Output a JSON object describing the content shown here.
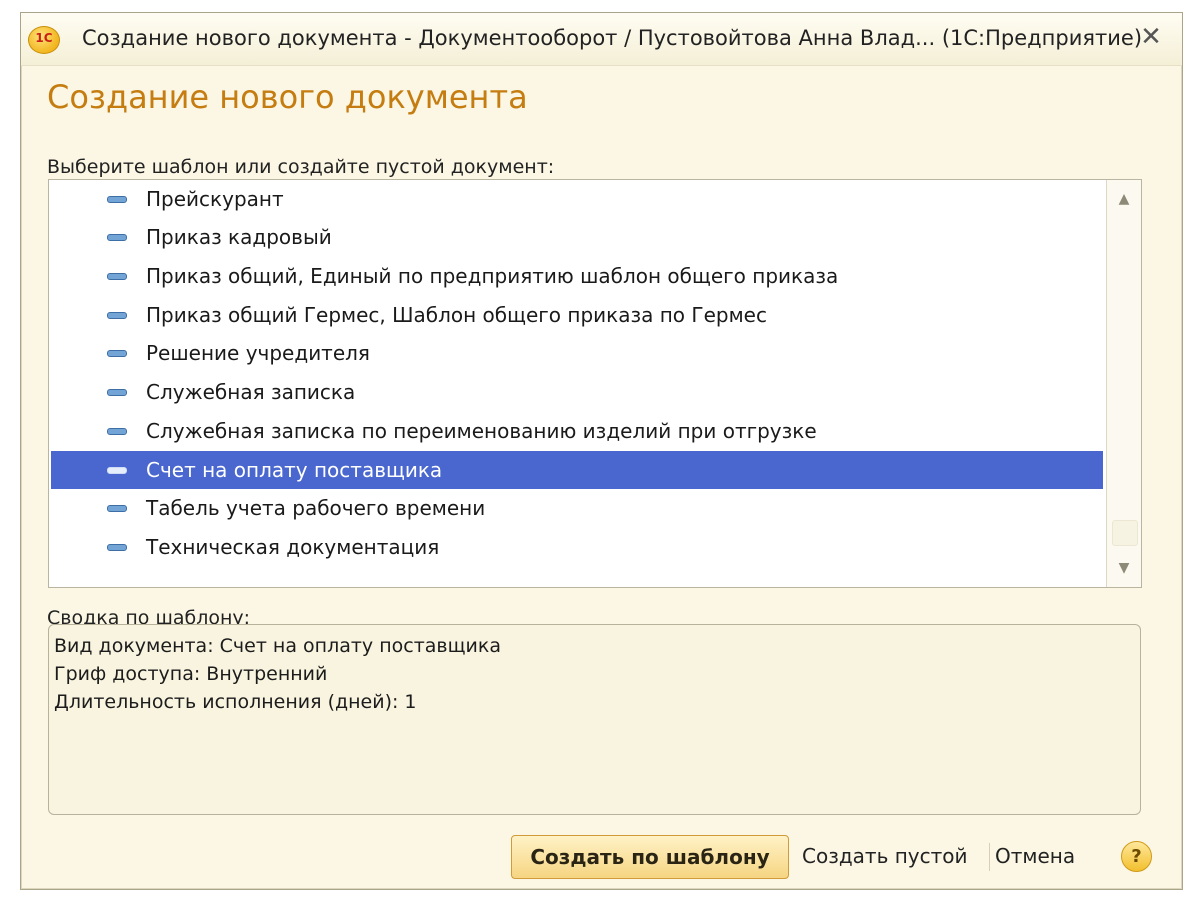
{
  "window": {
    "title": "Создание нового документа - Документооборот / Пустовойтова Анна Влад...  (1С:Предприятие)",
    "logo_text": "1С",
    "close_glyph": "✕"
  },
  "heading": "Создание нового документа",
  "prompt": "Выберите шаблон или создайте пустой документ:",
  "templates": [
    {
      "label": "Прейскурант",
      "selected": false
    },
    {
      "label": "Приказ кадровый",
      "selected": false
    },
    {
      "label": "Приказ общий, Единый по предприятию шаблон общего приказа",
      "selected": false
    },
    {
      "label": "Приказ общий Гермес, Шаблон общего приказа по Гермес",
      "selected": false
    },
    {
      "label": "Решение учредителя",
      "selected": false
    },
    {
      "label": "Служебная записка",
      "selected": false
    },
    {
      "label": "Служебная записка по переименованию изделий при отгрузке",
      "selected": false
    },
    {
      "label": "Счет на оплату поставщика",
      "selected": true
    },
    {
      "label": "Табель учета рабочего времени",
      "selected": false
    },
    {
      "label": "Техническая документация",
      "selected": false
    }
  ],
  "scrollbar": {
    "up_glyph": "▲",
    "down_glyph": "▼"
  },
  "summary": {
    "label": "Сводка по шаблону:",
    "lines": [
      "Вид документа: Счет на оплату поставщика",
      "Гриф доступа: Внутренний",
      "Длительность исполнения (дней): 1"
    ]
  },
  "buttons": {
    "create_from_template": "Создать по шаблону",
    "create_empty": "Создать пустой",
    "cancel": "Отмена",
    "help": "?"
  },
  "colors": {
    "heading": "#c57c10",
    "selection": "#4967ce",
    "window_background": "#fbf7e4"
  }
}
